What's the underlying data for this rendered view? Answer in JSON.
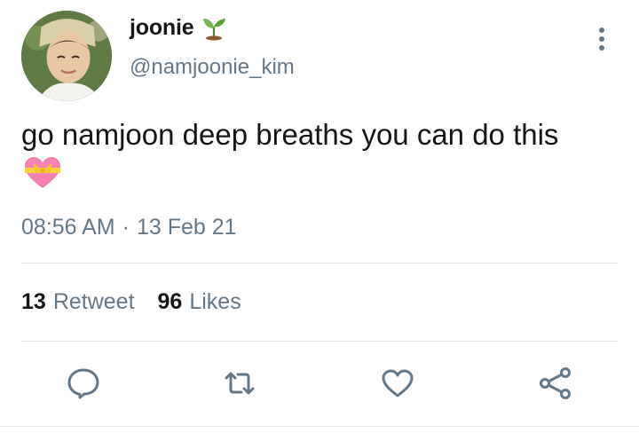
{
  "user": {
    "display_name": "joonie",
    "handle": "@namjoonie_kim",
    "name_emoji_icon": "sprout-icon"
  },
  "tweet": {
    "text": "go namjoon deep breaths you can do this",
    "emoji_icon": "heart-with-ribbon-icon",
    "time": "08:56 AM",
    "separator": "·",
    "date": "13 Feb 21"
  },
  "stats": {
    "retweets_count": "13",
    "retweets_label": "Retweet",
    "likes_count": "96",
    "likes_label": "Likes"
  },
  "actions": [
    "reply-icon",
    "retweet-icon",
    "like-icon",
    "share-icon"
  ],
  "colors": {
    "text": "#14171a",
    "secondary": "#657786",
    "icon": "#657786",
    "divider": "#dfe3e6"
  }
}
